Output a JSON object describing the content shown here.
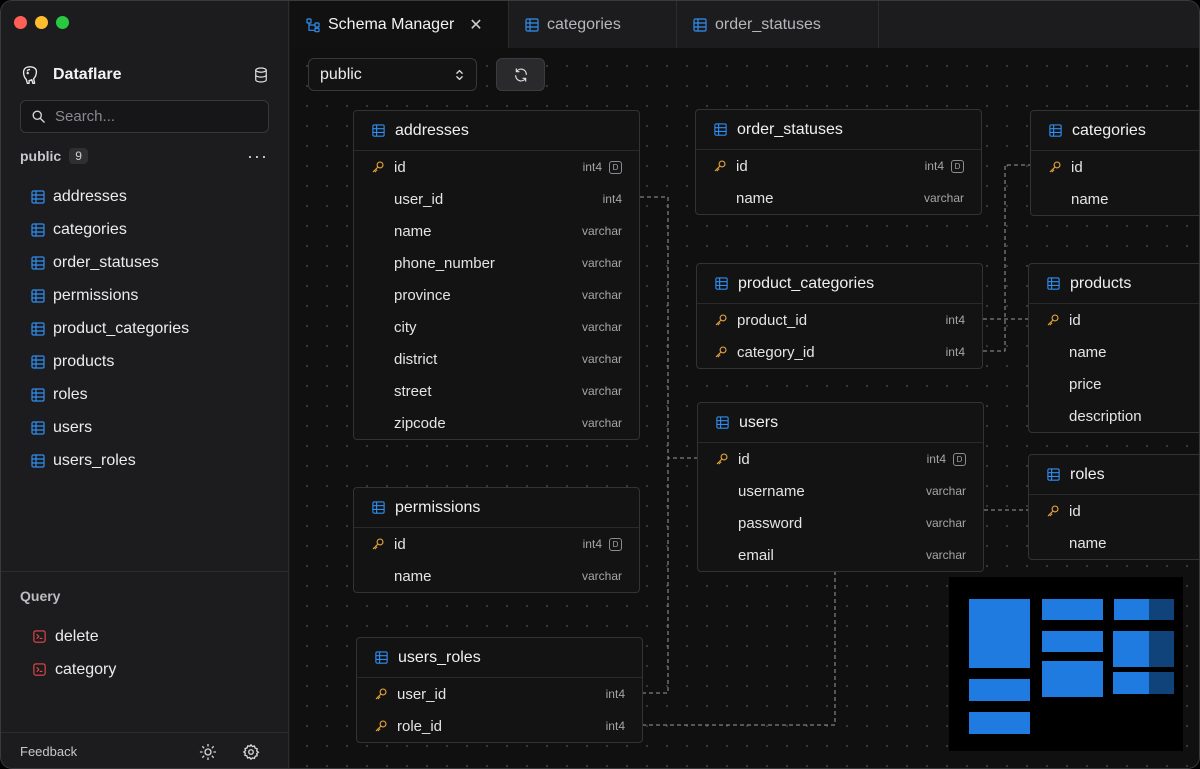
{
  "window": {
    "traffic_lights": {
      "close": "#ff5f57",
      "minimize": "#febc2e",
      "zoom": "#28c840"
    }
  },
  "sidebar": {
    "app_name": "Dataflare",
    "search_placeholder": "Search...",
    "schema": {
      "name": "public",
      "count": "9",
      "more": "···"
    },
    "tables": [
      "addresses",
      "categories",
      "order_statuses",
      "permissions",
      "product_categories",
      "products",
      "roles",
      "users",
      "users_roles"
    ],
    "query_heading": "Query",
    "queries": [
      "delete",
      "category"
    ],
    "feedback_label": "Feedback"
  },
  "tabs": [
    {
      "label": "Schema Manager",
      "icon": "schema-icon",
      "active": true,
      "close": "✕"
    },
    {
      "label": "categories",
      "icon": "table-icon",
      "active": false
    },
    {
      "label": "order_statuses",
      "icon": "table-icon",
      "active": false
    }
  ],
  "toolbar": {
    "schema_value": "public"
  },
  "tables": {
    "addresses": {
      "name": "addresses",
      "columns": [
        {
          "name": "id",
          "type": "int4",
          "pk": true,
          "badge": "D"
        },
        {
          "name": "user_id",
          "type": "int4"
        },
        {
          "name": "name",
          "type": "varchar"
        },
        {
          "name": "phone_number",
          "type": "varchar"
        },
        {
          "name": "province",
          "type": "varchar"
        },
        {
          "name": "city",
          "type": "varchar"
        },
        {
          "name": "district",
          "type": "varchar"
        },
        {
          "name": "street",
          "type": "varchar"
        },
        {
          "name": "zipcode",
          "type": "varchar"
        }
      ]
    },
    "order_statuses": {
      "name": "order_statuses",
      "columns": [
        {
          "name": "id",
          "type": "int4",
          "pk": true,
          "badge": "D"
        },
        {
          "name": "name",
          "type": "varchar"
        }
      ]
    },
    "categories": {
      "name": "categories",
      "columns": [
        {
          "name": "id",
          "pk": true
        },
        {
          "name": "name"
        }
      ]
    },
    "product_categories": {
      "name": "product_categories",
      "columns": [
        {
          "name": "product_id",
          "type": "int4",
          "pk": true
        },
        {
          "name": "category_id",
          "type": "int4",
          "pk": true
        }
      ]
    },
    "products": {
      "name": "products",
      "columns": [
        {
          "name": "id",
          "pk": true
        },
        {
          "name": "name"
        },
        {
          "name": "price"
        },
        {
          "name": "description"
        }
      ]
    },
    "users": {
      "name": "users",
      "columns": [
        {
          "name": "id",
          "type": "int4",
          "pk": true,
          "badge": "D"
        },
        {
          "name": "username",
          "type": "varchar"
        },
        {
          "name": "password",
          "type": "varchar"
        },
        {
          "name": "email",
          "type": "varchar"
        }
      ]
    },
    "roles": {
      "name": "roles",
      "columns": [
        {
          "name": "id",
          "pk": true
        },
        {
          "name": "name"
        }
      ]
    },
    "permissions": {
      "name": "permissions",
      "columns": [
        {
          "name": "id",
          "type": "int4",
          "pk": true,
          "badge": "D"
        },
        {
          "name": "name",
          "type": "varchar"
        }
      ]
    },
    "users_roles": {
      "name": "users_roles",
      "columns": [
        {
          "name": "user_id",
          "type": "int4",
          "pk": true
        },
        {
          "name": "role_id",
          "type": "int4",
          "pk": true
        }
      ]
    }
  },
  "colors": {
    "accent_blue": "#2f8ef0",
    "key_orange": "#e0a03a",
    "query_red": "#e5484d",
    "minimap_blue": "#1f7be0"
  }
}
